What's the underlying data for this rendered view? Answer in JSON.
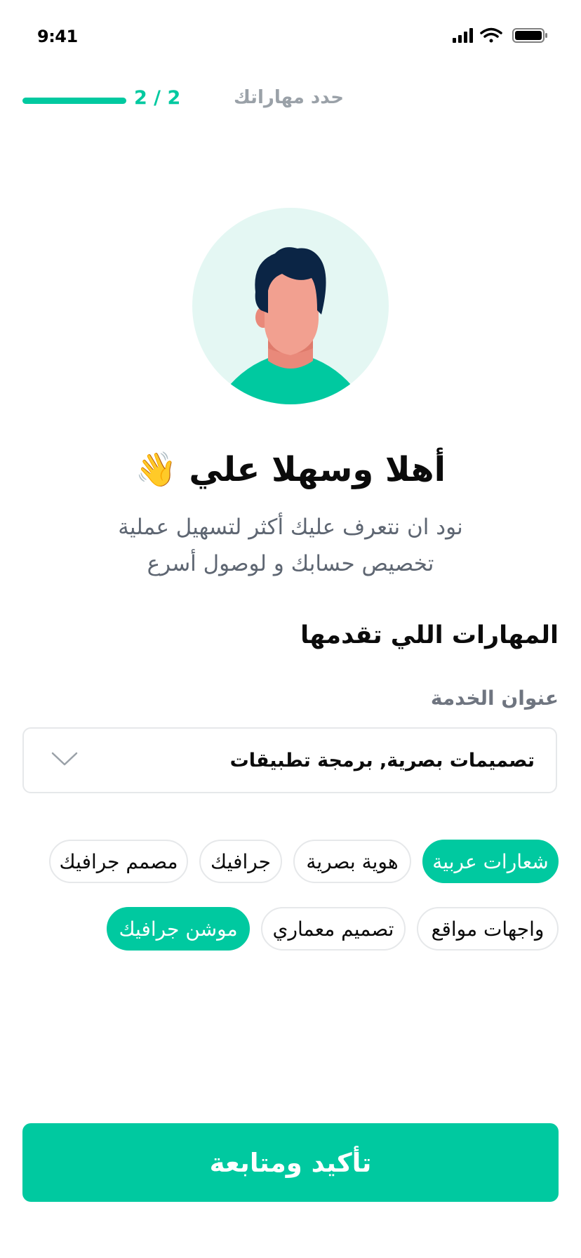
{
  "status_bar": {
    "time": "9:41"
  },
  "header": {
    "step_count": "2 / 2",
    "step_title": "حدد مهاراتك",
    "progress": 1.0
  },
  "headline": "أهلا وسهلا علي 👋",
  "subtitle_lines": [
    "نود ان نتعرف عليك أكثر لتسهيل عملية",
    "تخصيص حسابك و لوصول أسرع"
  ],
  "section_title": "المهارات اللي تقدمها",
  "service_field": {
    "label": "عنوان الخدمة",
    "value": "تصميمات بصرية, برمجة تطبيقات"
  },
  "chips": [
    {
      "label": "شعارات عربية",
      "selected": true
    },
    {
      "label": "هوية بصرية",
      "selected": false
    },
    {
      "label": "جرافيك",
      "selected": false
    },
    {
      "label": "مصمم جرافيك",
      "selected": false
    },
    {
      "label": "واجهات مواقع",
      "selected": false
    },
    {
      "label": "تصميم معماري",
      "selected": false
    },
    {
      "label": "موشن جرافيك",
      "selected": true
    }
  ],
  "cta_label": "تأكيد ومتابعة",
  "colors": {
    "accent": "#00c9a0",
    "avatar_bg": "#e4f7f3",
    "hair": "#0b2545",
    "skin": "#f2a090"
  }
}
